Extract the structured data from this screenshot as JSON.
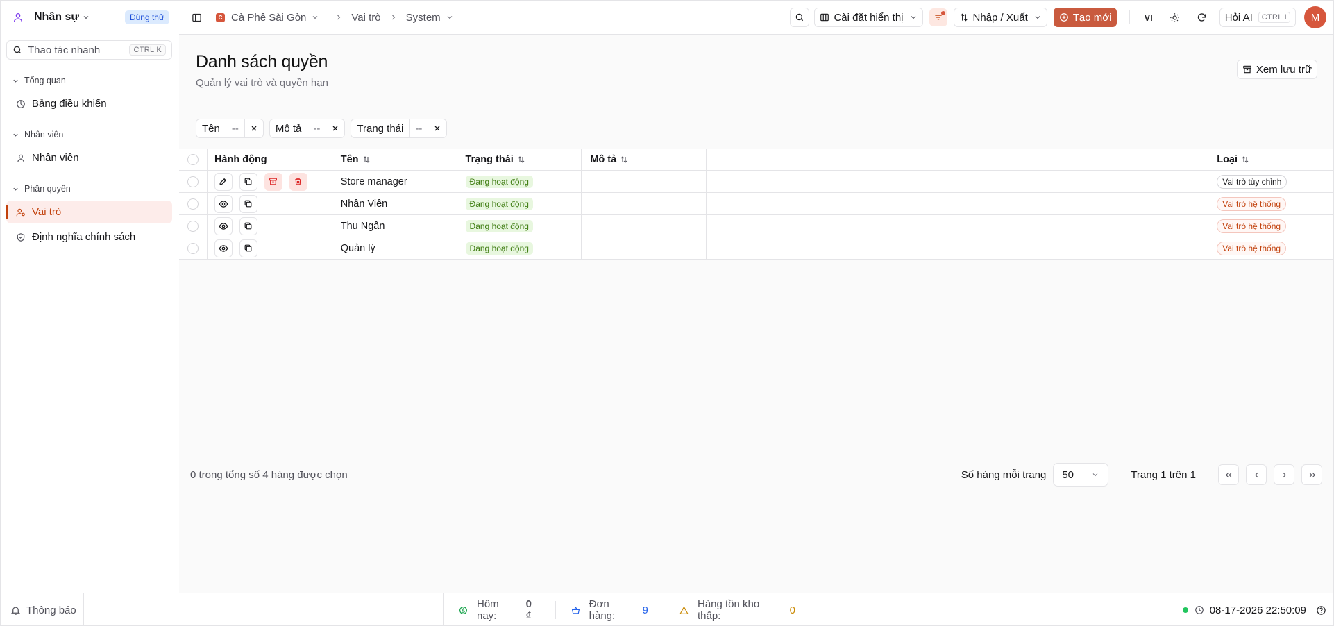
{
  "colors": {
    "accent": "#c95a3e",
    "active_bg": "#fdecea",
    "success": "#22c55e",
    "info_badge_bg": "#dbeafe"
  },
  "sidebar": {
    "app_name": "Nhân sự",
    "trial_badge": "Dùng thử",
    "quick_action": {
      "placeholder": "Thao tác nhanh",
      "shortcut": "CTRL K"
    },
    "groups": [
      {
        "label": "Tổng quan",
        "items": [
          {
            "label": "Bảng điều khiển",
            "icon": "gauge-icon"
          }
        ]
      },
      {
        "label": "Nhân viên",
        "items": [
          {
            "label": "Nhân viên",
            "icon": "user-icon"
          }
        ]
      },
      {
        "label": "Phân quyền",
        "items": [
          {
            "label": "Vai trò",
            "icon": "user-cog-icon",
            "active": true
          },
          {
            "label": "Định nghĩa chính sách",
            "icon": "shield-check-icon"
          }
        ]
      }
    ]
  },
  "header": {
    "breadcrumbs": [
      "Cà Phê Sài Gòn",
      "Vai trò",
      "System"
    ],
    "display_settings": "Cài đặt hiển thị",
    "import_export": "Nhập / Xuất",
    "create_new": "Tạo mới",
    "language": "VI",
    "ask_ai": "Hỏi AI",
    "ask_ai_shortcut": "CTRL I",
    "user_initial": "M"
  },
  "page": {
    "title": "Danh sách quyền",
    "subtitle": "Quản lý vai trò và quyền hạn",
    "archive_button": "Xem lưu trữ",
    "filters": [
      {
        "label": "Tên",
        "value": "--"
      },
      {
        "label": "Mô tả",
        "value": "--"
      },
      {
        "label": "Trạng thái",
        "value": "--"
      }
    ]
  },
  "table": {
    "columns": [
      "Hành động",
      "Tên",
      "Trạng thái",
      "Mô tả",
      "",
      "Loại"
    ],
    "rows": [
      {
        "name": "Store manager",
        "status": "Đang hoạt động",
        "description": "",
        "type": "Vai trò tùy chỉnh",
        "type_kind": "custom",
        "actions": [
          "edit",
          "copy",
          "archive",
          "delete"
        ]
      },
      {
        "name": "Nhân Viên",
        "status": "Đang hoạt động",
        "description": "",
        "type": "Vai trò hệ thống",
        "type_kind": "system",
        "actions": [
          "view",
          "copy"
        ]
      },
      {
        "name": "Thu Ngân",
        "status": "Đang hoạt động",
        "description": "",
        "type": "Vai trò hệ thống",
        "type_kind": "system",
        "actions": [
          "view",
          "copy"
        ]
      },
      {
        "name": "Quản lý",
        "status": "Đang hoạt động",
        "description": "",
        "type": "Vai trò hệ thống",
        "type_kind": "system",
        "actions": [
          "view",
          "copy"
        ]
      }
    ]
  },
  "footer": {
    "selection": "0 trong tổng số 4 hàng được chọn",
    "rows_per_page_label": "Số hàng mỗi trang",
    "rows_per_page": "50",
    "page_info": "Trang 1 trên 1"
  },
  "status_bar": {
    "notifications": "Thông báo",
    "stats": [
      {
        "label": "Hôm nay:",
        "value": "0 ₫",
        "value_color": "#18181b",
        "icon": "dollar-circle-icon"
      },
      {
        "label": "Đơn hàng:",
        "value": "9",
        "value_color": "#2563eb",
        "icon": "basket-icon"
      },
      {
        "label": "Hàng tồn kho thấp:",
        "value": "0",
        "value_color": "#ca8a04",
        "icon": "warning-icon"
      }
    ],
    "datetime": "08-17-2026 22:50:09"
  }
}
